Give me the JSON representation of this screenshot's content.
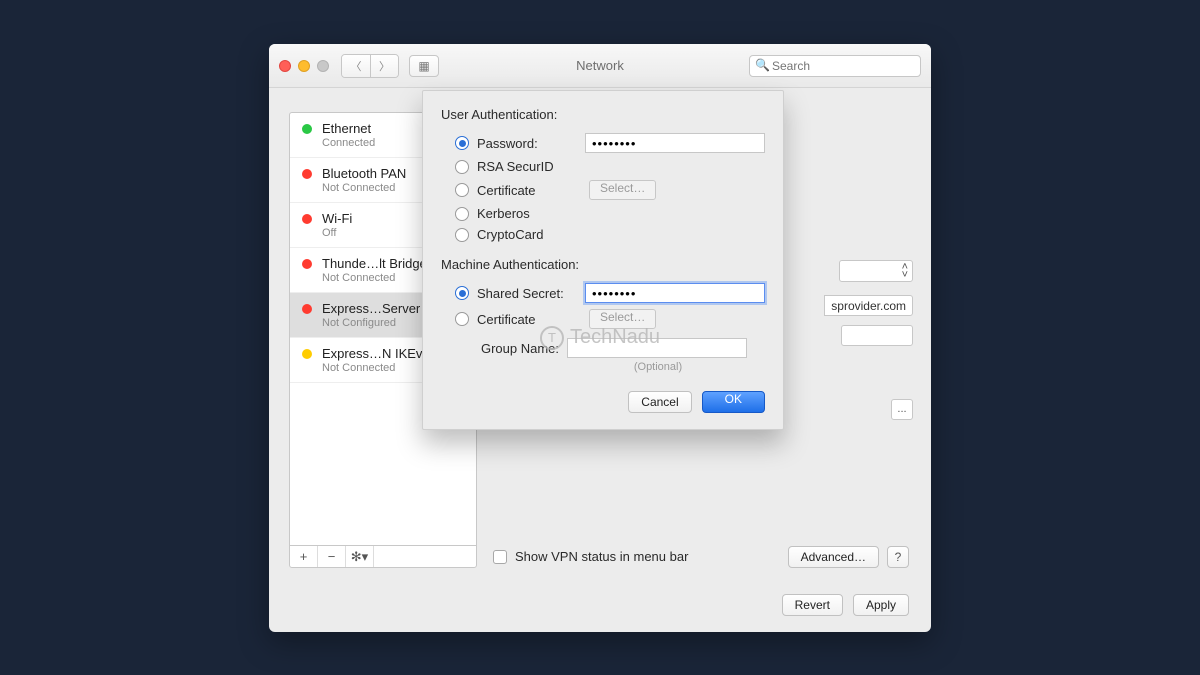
{
  "window": {
    "title": "Network",
    "search_placeholder": "Search"
  },
  "sidebar": {
    "items": [
      {
        "name": "Ethernet",
        "status": "Connected",
        "color": "green"
      },
      {
        "name": "Bluetooth PAN",
        "status": "Not Connected",
        "color": "red"
      },
      {
        "name": "Wi-Fi",
        "status": "Off",
        "color": "red"
      },
      {
        "name": "Thunde…lt Bridge",
        "status": "Not Connected",
        "color": "red"
      },
      {
        "name": "Express…Server",
        "status": "Not Configured",
        "color": "red"
      },
      {
        "name": "Express…N IKEv2",
        "status": "Not Connected",
        "color": "yellow"
      }
    ],
    "selected_index": 4,
    "tools": {
      "add": "+",
      "remove": "−",
      "action": "✻▾"
    }
  },
  "right_panel": {
    "server_peek": "sprovider.com",
    "ellipsis": "..."
  },
  "vpn_checkbox_label": "Show VPN status in menu bar",
  "advanced_label": "Advanced…",
  "help_label": "?",
  "footer": {
    "revert": "Revert",
    "apply": "Apply"
  },
  "sheet": {
    "user_auth_title": "User Authentication:",
    "options": {
      "password": "Password:",
      "rsa": "RSA SecurID",
      "certificate": "Certificate",
      "kerberos": "Kerberos",
      "cryptocard": "CryptoCard"
    },
    "password_value": "••••••••",
    "select_label": "Select…",
    "machine_auth_title": "Machine Authentication:",
    "machine_options": {
      "shared_secret": "Shared Secret:",
      "certificate": "Certificate"
    },
    "shared_secret_value": "••••••••",
    "group_name_label": "Group Name:",
    "group_name_value": "",
    "optional_label": "(Optional)",
    "cancel": "Cancel",
    "ok": "OK"
  },
  "watermark": "TechNadu"
}
